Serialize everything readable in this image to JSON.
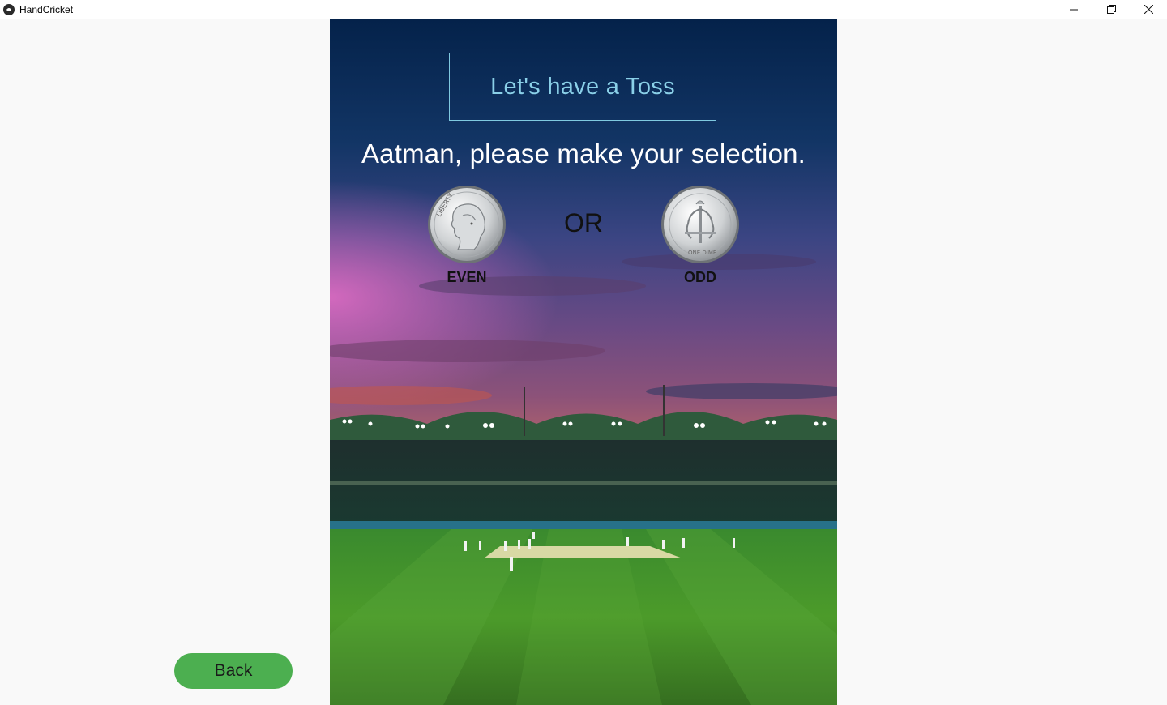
{
  "window": {
    "title": "HandCricket",
    "controls": {
      "minimize": "—",
      "maximize": "❐",
      "close": "✕"
    }
  },
  "toss": {
    "heading": "Let's have a Toss",
    "prompt": "Aatman, please make your selection.",
    "separator": "OR",
    "options": [
      {
        "label": "EVEN",
        "icon": "dime-heads-icon"
      },
      {
        "label": "ODD",
        "icon": "dime-tails-icon"
      }
    ]
  },
  "navigation": {
    "back_label": "Back"
  },
  "colors": {
    "accent_green": "#4caf50",
    "heading_cyan": "#8ad0e8",
    "window_bg": "#f9f9f9"
  }
}
